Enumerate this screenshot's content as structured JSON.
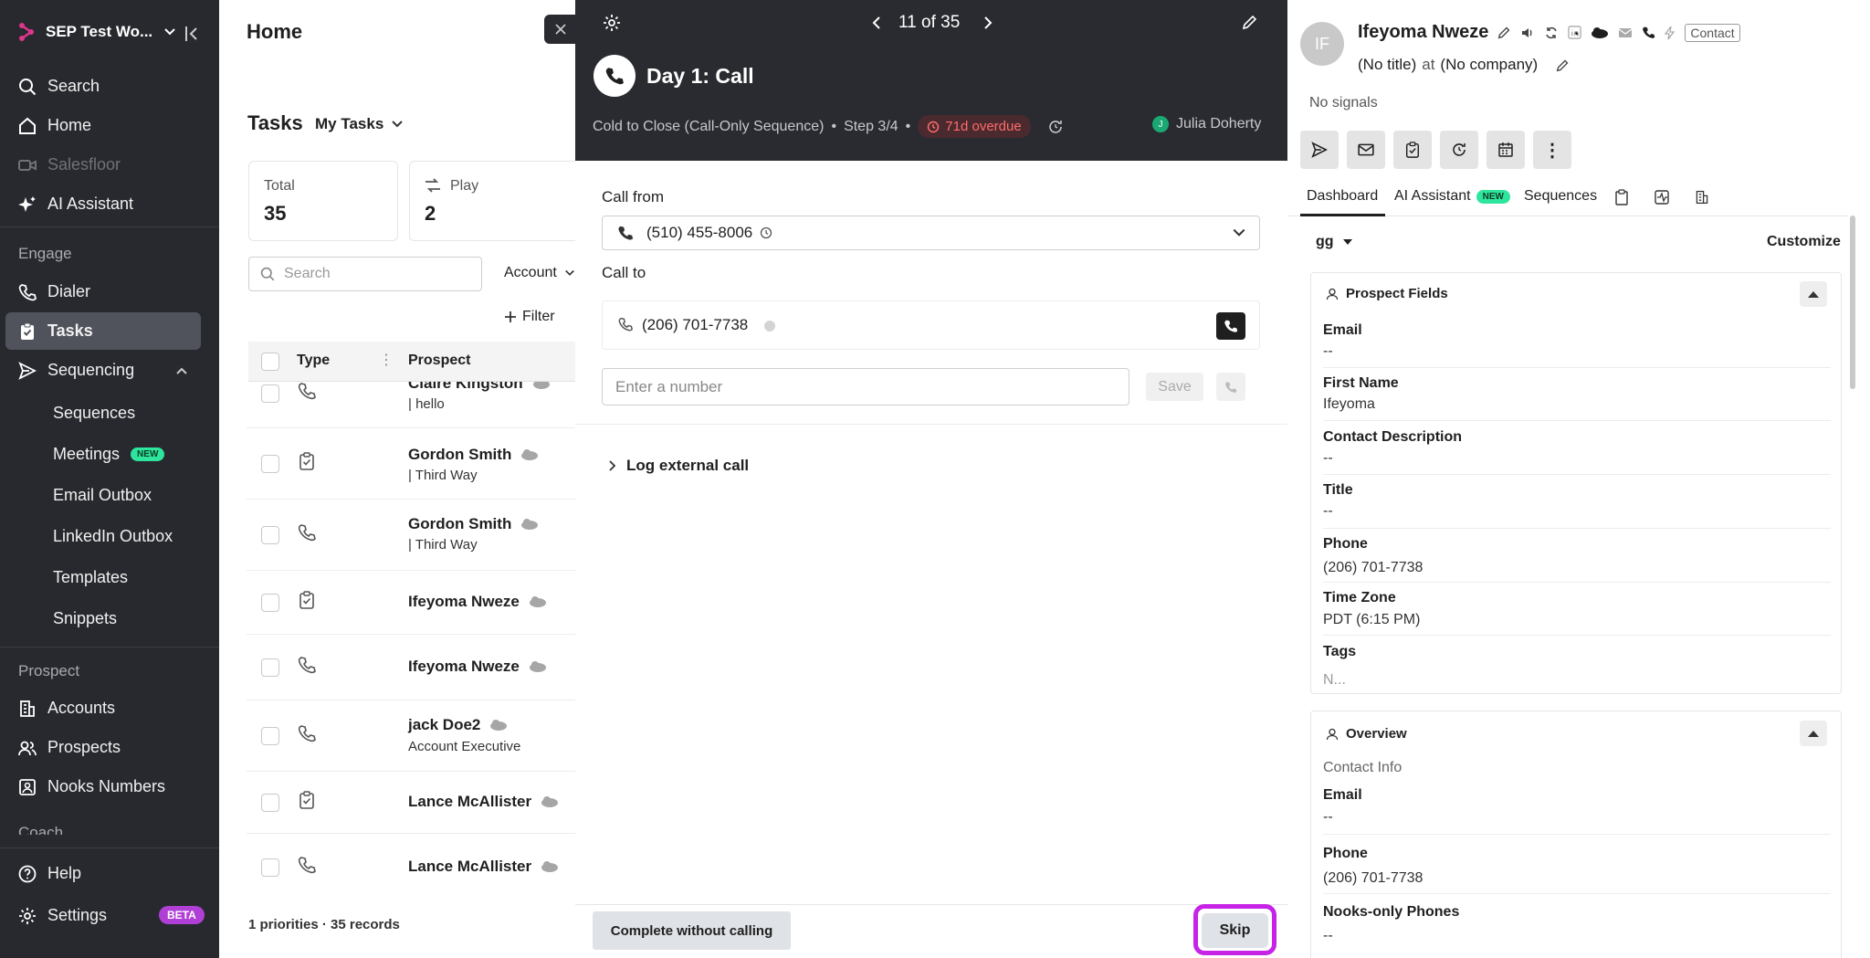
{
  "sidebar": {
    "workspace": "SEP Test Wo...",
    "nav_top": [
      "Search",
      "Home",
      "Salesfloor",
      "AI Assistant"
    ],
    "engage_label": "Engage",
    "engage": [
      "Dialer",
      "Tasks",
      "Sequencing"
    ],
    "sequencing_sub": [
      "Sequences",
      "Meetings",
      "Email Outbox",
      "LinkedIn Outbox",
      "Templates",
      "Snippets"
    ],
    "new_badge": "NEW",
    "prospect_label": "Prospect",
    "prospect": [
      "Accounts",
      "Prospects",
      "Nooks Numbers"
    ],
    "coach_label": "Coach",
    "help": "Help",
    "settings": "Settings",
    "beta_badge": "BETA"
  },
  "list": {
    "page_title": "Home",
    "tasks_title": "Tasks",
    "my_tasks": "My Tasks",
    "total_label": "Total",
    "total_value": "35",
    "play_label": "Play",
    "play_value": "2",
    "search_placeholder": "Search",
    "account_filter": "Account",
    "filter_button": "Filter",
    "col_type": "Type",
    "col_prospect": "Prospect",
    "rows": [
      {
        "name": "Claire Kingston",
        "sub": "| hello",
        "type": "call"
      },
      {
        "name": "Gordon Smith",
        "sub": "| Third Way",
        "type": "task"
      },
      {
        "name": "Gordon Smith",
        "sub": "| Third Way",
        "type": "call"
      },
      {
        "name": "Ifeyoma Nweze",
        "sub": "",
        "type": "task"
      },
      {
        "name": "Ifeyoma Nweze",
        "sub": "",
        "type": "call"
      },
      {
        "name": "jack Doe2",
        "sub": "Account Executive",
        "type": "call"
      },
      {
        "name": "Lance McAllister",
        "sub": "",
        "type": "task"
      },
      {
        "name": "Lance McAllister",
        "sub": "",
        "type": "call"
      }
    ],
    "footer": "1 priorities · 35 records"
  },
  "panel": {
    "pager": "11 of 35",
    "task_title": "Day 1: Call",
    "sequence": "Cold to Close (Call-Only Sequence)",
    "step": "Step 3/4",
    "overdue": "71d overdue",
    "owner_initial": "J",
    "owner": "Julia Doherty",
    "call_from_label": "Call from",
    "call_from_number": "(510) 455-8006",
    "call_to_label": "Call to",
    "call_to_number": "(206) 701-7738",
    "number_placeholder": "Enter a number",
    "save": "Save",
    "log_external": "Log external call",
    "complete_without_calling": "Complete without calling",
    "skip": "Skip"
  },
  "contact": {
    "initials": "IF",
    "name": "Ifeyoma Nweze",
    "contact_badge": "Contact",
    "no_title": "(No title)",
    "at": "at",
    "no_company": "(No company)",
    "signals": "No signals",
    "tabs": [
      "Dashboard",
      "AI Assistant",
      "Sequences"
    ],
    "tab_new": "NEW",
    "view_name": "gg",
    "customize": "Customize",
    "prospect_fields_title": "Prospect Fields",
    "fields": [
      {
        "label": "Email",
        "value": "--"
      },
      {
        "label": "First Name",
        "value": "Ifeyoma"
      },
      {
        "label": "Contact Description",
        "value": "--"
      },
      {
        "label": "Title",
        "value": "--"
      },
      {
        "label": "Phone",
        "value": "(206) 701-7738"
      },
      {
        "label": "Time Zone",
        "value": "PDT (6:15 PM)"
      },
      {
        "label": "Tags",
        "value": "N..."
      }
    ],
    "overview_title": "Overview",
    "contact_info": "Contact Info",
    "overview_fields": [
      {
        "label": "Email",
        "value": "--"
      },
      {
        "label": "Phone",
        "value": "(206) 701-7738"
      },
      {
        "label": "Nooks-only Phones",
        "value": "--"
      }
    ]
  },
  "colors": {
    "sidebar_bg": "#27292e",
    "panel_head_bg": "#2a2b30",
    "skip_highlight": "#c623e6",
    "new_badge": "#2ee59d"
  }
}
